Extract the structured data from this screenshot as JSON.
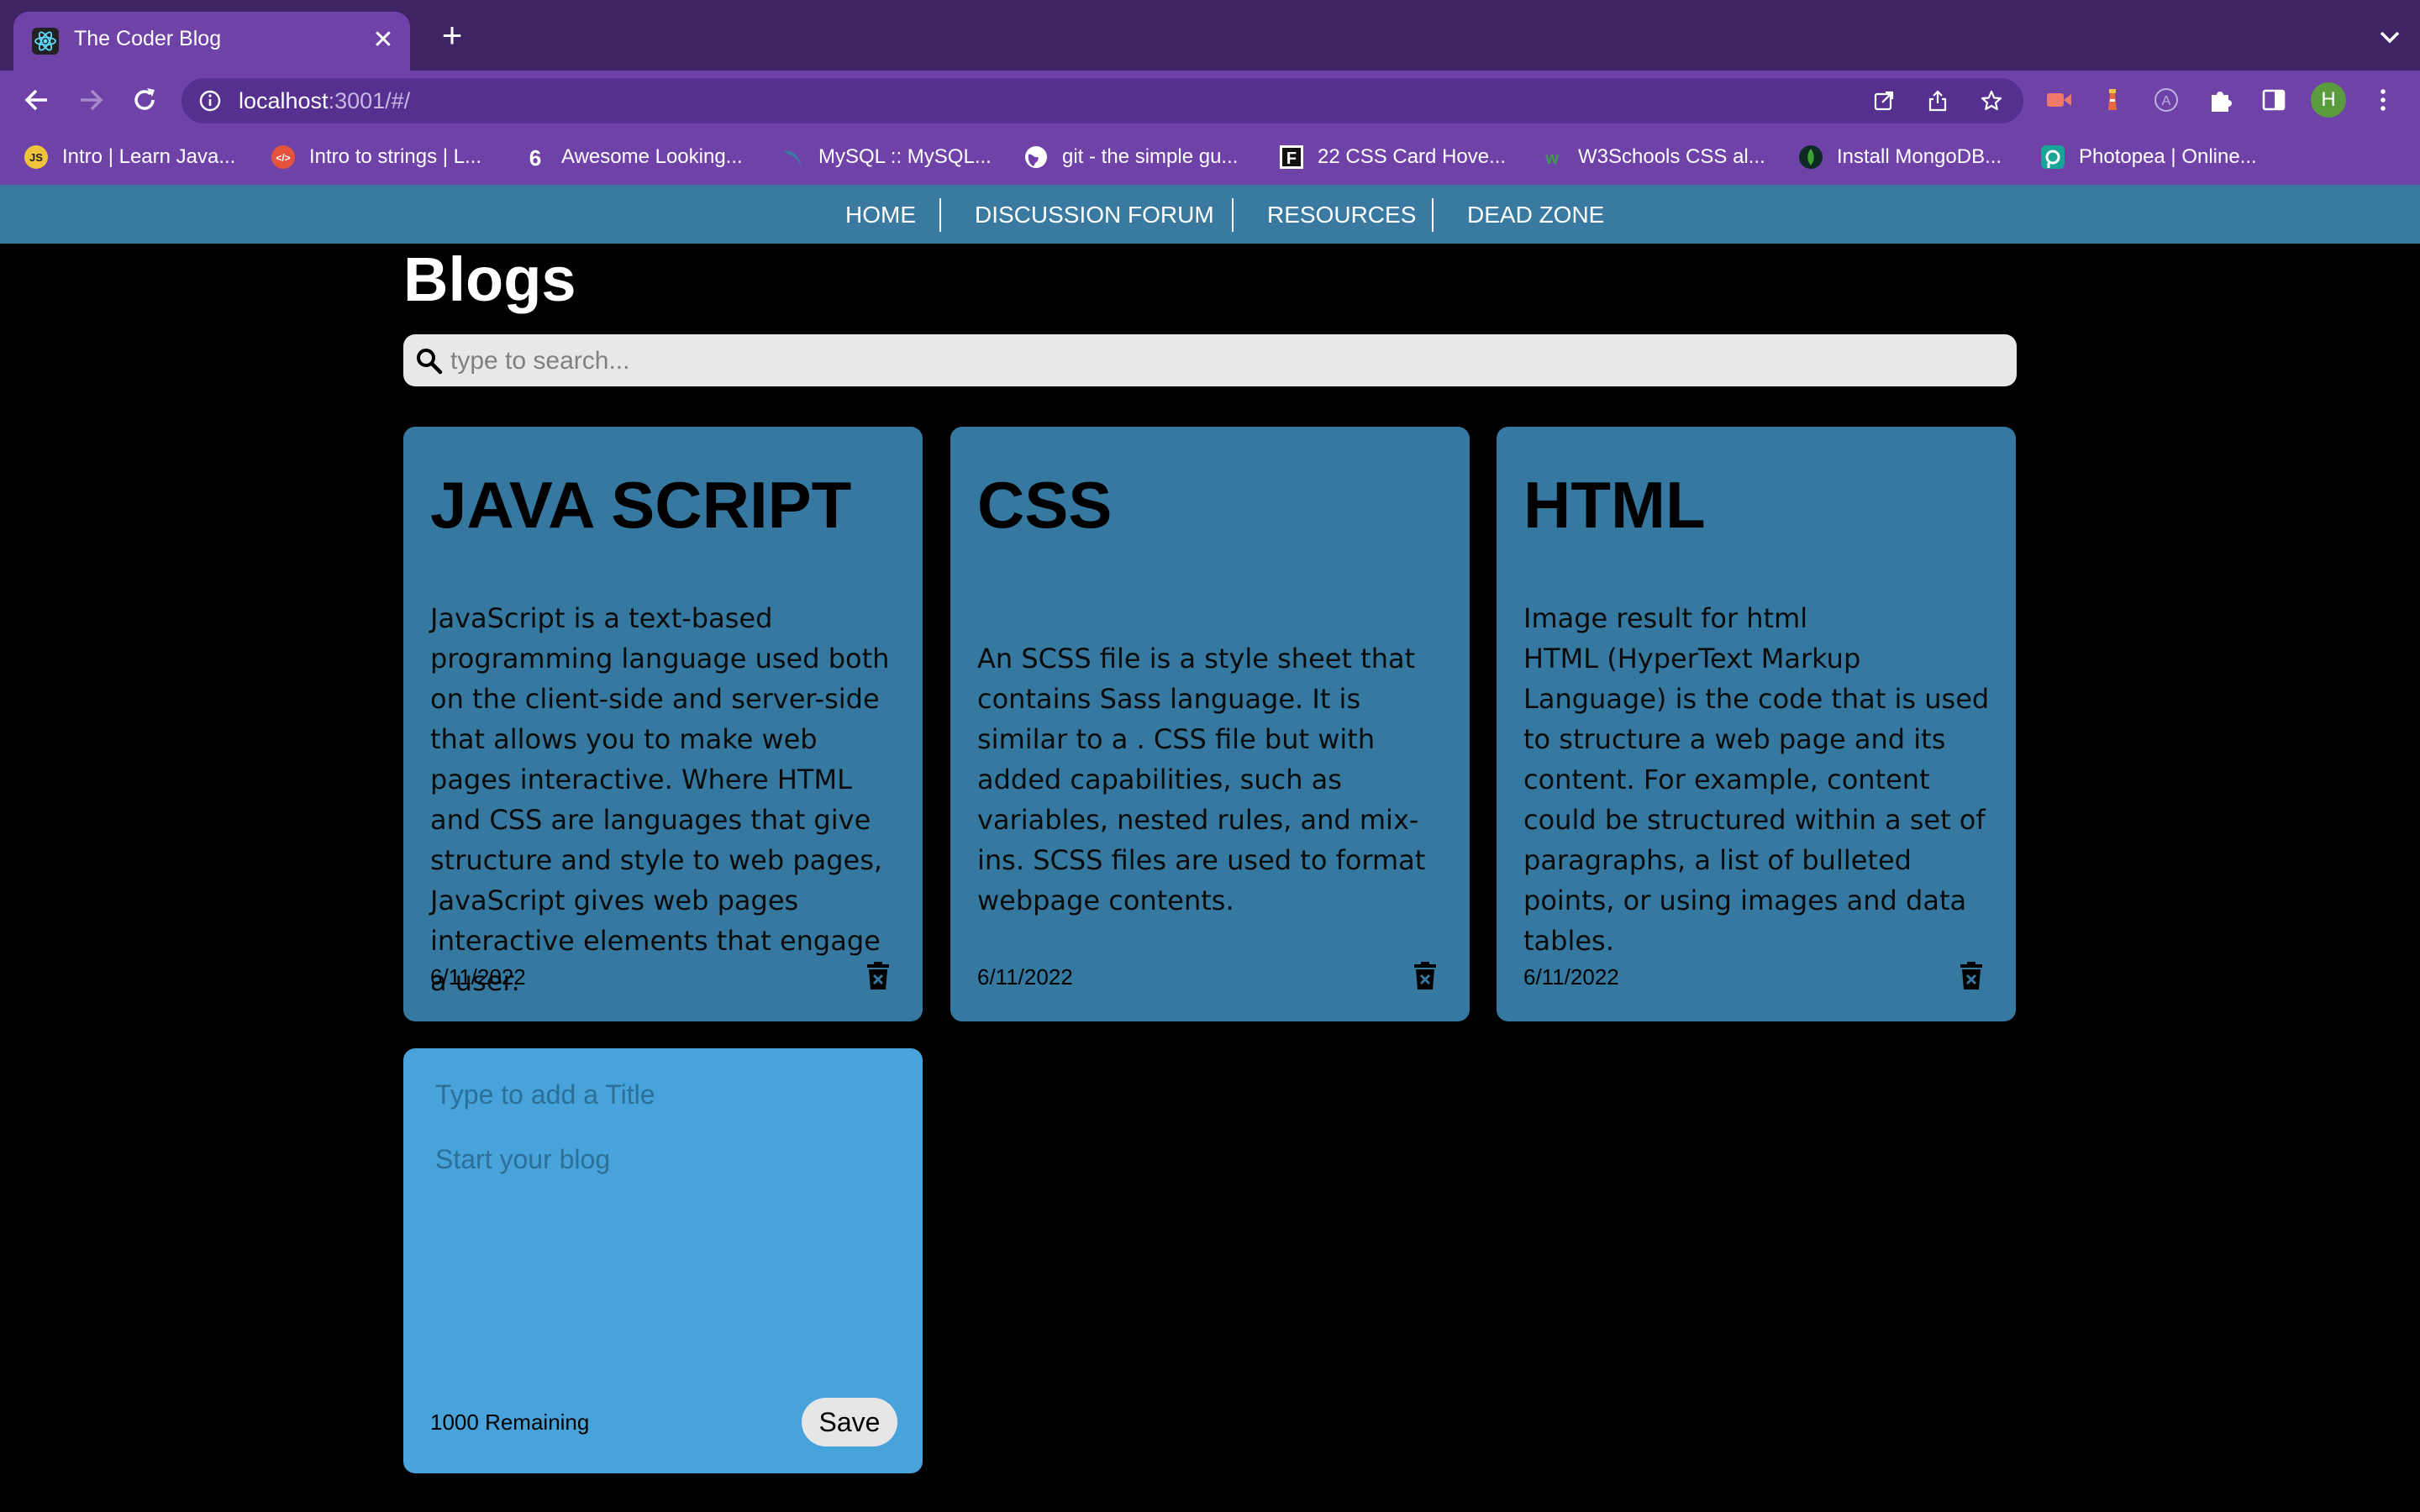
{
  "browser": {
    "tab_title": "The Coder Blog",
    "url_host": "localhost",
    "url_rest": ":3001/#/",
    "avatar_letter": "H",
    "bookmarks": [
      {
        "label": "Intro | Learn Java...",
        "icon": "js-icon",
        "color": "#f0c43a"
      },
      {
        "label": "Intro to strings | L...",
        "icon": "code-icon",
        "color": "#e5533d"
      },
      {
        "label": "Awesome Looking...",
        "icon": "six-icon",
        "color": "#ffffff"
      },
      {
        "label": "MySQL :: MySQL...",
        "icon": "mysql-icon",
        "color": "#3a7aa0"
      },
      {
        "label": "git - the simple gu...",
        "icon": "globe-icon",
        "color": "#ffffff"
      },
      {
        "label": "22 CSS Card Hove...",
        "icon": "f-icon",
        "color": "#ffffff"
      },
      {
        "label": "W3Schools CSS al...",
        "icon": "w3-icon",
        "color": "#3e9b4f"
      },
      {
        "label": "Install MongoDB...",
        "icon": "mongodb-icon",
        "color": "#3fa037"
      },
      {
        "label": "Photopea | Online...",
        "icon": "photopea-icon",
        "color": "#18a497"
      }
    ]
  },
  "nav": {
    "items": [
      "HOME",
      "DISCUSSION FORUM",
      "RESOURCES",
      "DEAD ZONE"
    ]
  },
  "page": {
    "title": "Blogs",
    "search_placeholder": "type to search..."
  },
  "blogs": [
    {
      "title": "JAVA SCRIPT",
      "body": "JavaScript is a text-based programming language used both on the client-side and server-side that allows you to make web pages interactive. Where HTML and CSS are languages that give structure and style to web pages, JavaScript gives web pages interactive elements that engage a user.",
      "date": "6/11/2022"
    },
    {
      "title": "CSS",
      "body": "An SCSS file is a style sheet that contains Sass language. It is similar to a . CSS file but with added capabilities, such as variables, nested rules, and mix-ins. SCSS files are used to format webpage contents.",
      "date": "6/11/2022"
    },
    {
      "title": "HTML",
      "body": "Image result for html\nHTML (HyperText Markup Language) is the code that is used to structure a web page and its content. For example, content could be structured within a set of paragraphs, a list of bulleted points, or using images and data tables.",
      "date": "6/11/2022"
    }
  ],
  "new_blog": {
    "title_placeholder": "Type to add a Title",
    "body_placeholder": "Start your blog",
    "remaining": "1000 Remaining",
    "save_label": "Save"
  },
  "colors": {
    "tab_strip": "#3f2466",
    "toolbar": "#6f42a8",
    "site_nav": "#3a7aa0",
    "card": "#3579a1",
    "new_card": "#47a3d9"
  }
}
